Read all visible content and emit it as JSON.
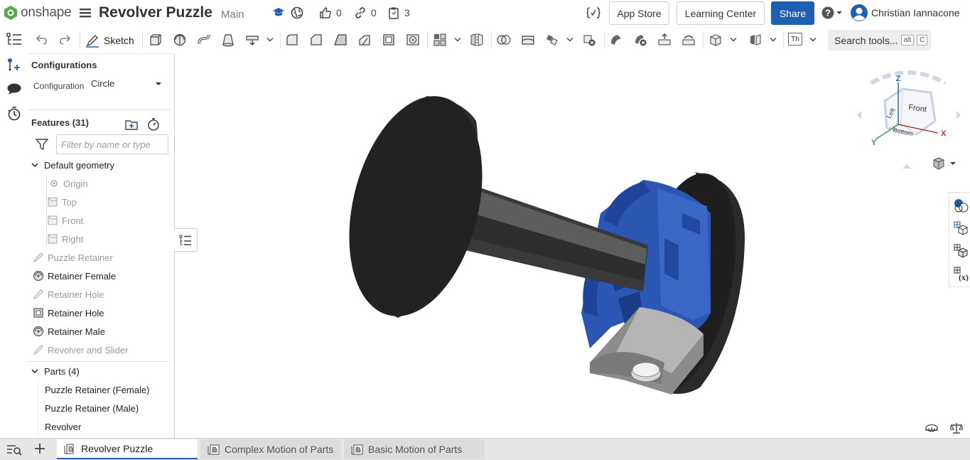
{
  "app": {
    "name": "onshape"
  },
  "document": {
    "title": "Revolver Puzzle",
    "workspace": "Main"
  },
  "stats": {
    "likes": "0",
    "links": "0",
    "versions": "3"
  },
  "header": {
    "app_store": "App Store",
    "learning_center": "Learning Center",
    "share": "Share",
    "user_name": "Christian Iannacone"
  },
  "toolbar": {
    "sketch_label": "Sketch",
    "search_label": "Search tools...",
    "search_key1": "alt",
    "search_key2": "C",
    "text_tool": "Th"
  },
  "config": {
    "title": "Configurations",
    "label": "Configuration",
    "value": "Circle"
  },
  "features": {
    "title": "Features (31)",
    "filter_placeholder": "Filter by name or type",
    "default_geometry": "Default geometry",
    "geometry": [
      "Origin",
      "Top",
      "Front",
      "Right"
    ],
    "items": [
      {
        "label": "Puzzle Retainer",
        "icon": "sketch-icon",
        "dim": true
      },
      {
        "label": "Retainer Female",
        "icon": "revolve-icon",
        "dim": false
      },
      {
        "label": "Retainer Hole",
        "icon": "sketch-icon",
        "dim": true
      },
      {
        "label": "Retainer Hole",
        "icon": "shell-icon",
        "dim": false
      },
      {
        "label": "Retainer Male",
        "icon": "revolve-icon",
        "dim": false
      },
      {
        "label": "Revolver and Slider",
        "icon": "sketch-icon",
        "dim": true
      }
    ]
  },
  "parts": {
    "title": "Parts (4)",
    "items": [
      "Puzzle Retainer (Female)",
      "Puzzle Retainer (Male)",
      "Revolver"
    ]
  },
  "tabs": [
    {
      "label": "Revolver Puzzle",
      "active": true
    },
    {
      "label": "Complex Motion of Parts",
      "active": false
    },
    {
      "label": "Basic Motion of Parts",
      "active": false
    }
  ],
  "viewcube": {
    "top": "Z",
    "x_axis": "X",
    "y_axis": "Y",
    "front": "Front",
    "left": "Left",
    "bottom": "Bottom"
  },
  "colors": {
    "accent": "#1e5fb4",
    "part_blue": "#2b56b4",
    "part_dark": "#2a2a2a",
    "part_gray": "#9a9a9a"
  }
}
